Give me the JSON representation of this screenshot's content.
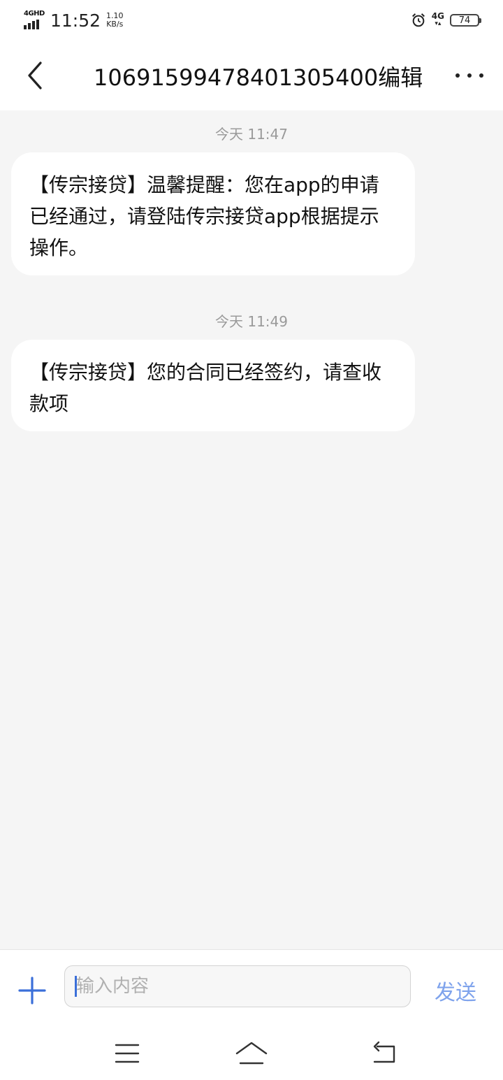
{
  "status_bar": {
    "network_label": "4GHD",
    "time": "11:52",
    "speed_value": "1.10",
    "speed_unit": "KB/s",
    "cell_label": "4G",
    "battery": "74"
  },
  "header": {
    "title": "1069159947840130540​0编辑"
  },
  "messages": [
    {
      "timestamp": "今天 11:47",
      "text": "【传宗接贷】温馨提醒：您在app的申请已经通过，请登陆传宗接贷app根据提示操作。"
    },
    {
      "timestamp": "今天 11:49",
      "text": "【传宗接贷】您的合同已经签约，请查收款项"
    }
  ],
  "composer": {
    "placeholder": "输入内容",
    "send_label": "发送"
  },
  "colors": {
    "accent": "#3b6fd9",
    "send": "#7fa3ec",
    "background": "#f5f5f5",
    "bubble": "#ffffff"
  }
}
